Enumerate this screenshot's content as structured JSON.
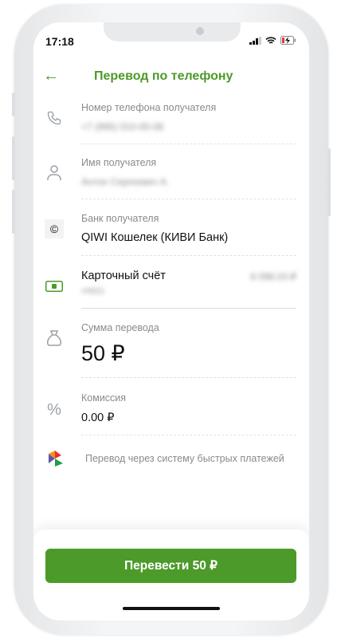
{
  "status": {
    "time": "17:18"
  },
  "header": {
    "title": "Перевод по телефону"
  },
  "fields": {
    "phone": {
      "label": "Номер телефона получателя",
      "value": "+7 (995) 010-00-08"
    },
    "name": {
      "label": "Имя получателя",
      "value": "Антон Сергеевич А."
    },
    "bank": {
      "label": "Банк получателя",
      "value": "QIWI Кошелек (КИВИ Банк)"
    },
    "account": {
      "title": "Карточный счёт",
      "number": "••0021",
      "balance": "8 098.03 ₽"
    },
    "amount": {
      "label": "Сумма перевода",
      "value": "50 ₽"
    },
    "fee": {
      "label": "Комиссия",
      "value": "0.00 ₽"
    }
  },
  "sbp_note": "Перевод через систему быстрых платежей",
  "submit_label": "Перевести 50 ₽",
  "colors": {
    "accent": "#4c9a2a"
  }
}
